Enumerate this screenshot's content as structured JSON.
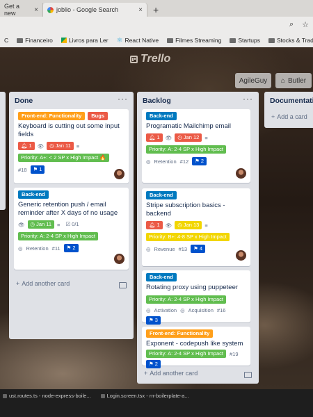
{
  "browser": {
    "tabs": [
      {
        "label": "Get a new"
      },
      {
        "label": "joblio - Google Search"
      }
    ],
    "new_tab": "+",
    "bookmarks": [
      "C",
      "Financeiro",
      "Livros para Ler",
      "React Native",
      "Filmes Streaming",
      "Startups",
      "Stocks & Trading..."
    ]
  },
  "board": {
    "logo": "Trello",
    "team_button": "AgileGuy",
    "butler_button": "Butler",
    "lists": {
      "done": {
        "title": "Done",
        "cards": [
          {
            "labels": [
              "Front-end: Functionality",
              "Bugs"
            ],
            "title": "Keyboard is cutting out some input fields",
            "votes": "1",
            "due": "Jan 11",
            "priority": "Priority: A+: < 2 SP x High Impact 🔥",
            "number": "#18",
            "tasks": "1"
          },
          {
            "labels": [
              "Back-end"
            ],
            "title": "Generic retention push / email reminder after X days of no usage",
            "due": "Jan 11",
            "checklist": "0/1",
            "priority": "Priority: A: 2-4 SP x High Impact",
            "category": "Retention",
            "number": "#11",
            "tasks": "2"
          }
        ],
        "add_card": "Add another card"
      },
      "backlog": {
        "title": "Backlog",
        "cards": [
          {
            "labels": [
              "Back-end"
            ],
            "title": "Programatic Mailchimp email",
            "votes": "1",
            "due": "Jan 12",
            "priority": "Priority: A: 2-4 SP x High Impact",
            "category": "Retention",
            "number": "#12",
            "tasks": "2"
          },
          {
            "labels": [
              "Back-end"
            ],
            "title": "Stripe subscription basics - backend",
            "votes": "1",
            "due": "Jan 13",
            "priority": "Priority: B+: 4-8 SP x High Impact",
            "category": "Revenue",
            "number": "#13",
            "tasks": "4"
          },
          {
            "labels": [
              "Back-end"
            ],
            "title": "Rotating proxy using puppeteer",
            "priority": "Priority: A: 2-4 SP x High Impact",
            "category": "Activation",
            "category2": "Acquisition",
            "number": "#16",
            "tasks": "3"
          },
          {
            "labels": [
              "Front-end: Functionality"
            ],
            "title": "Exponent - codepush like system",
            "priority": "Priority: A: 2-4 SP x High Impact",
            "number": "#19",
            "tasks": "2"
          }
        ],
        "add_card": "Add another card"
      },
      "documentation": {
        "title": "Documentation",
        "add_card": "Add a card"
      }
    }
  },
  "taskbar": {
    "items": [
      "ust.routes.ts - node-express-boile...",
      "Login.screen.tsx - rn-boilerplate-a..."
    ]
  },
  "colors": {
    "label_orange": "#ff9f1a",
    "label_red": "#eb5a46",
    "label_blue": "#0079bf",
    "due_green": "#61bd4f",
    "due_yellow": "#f2d600",
    "task_navy": "#0052cc"
  }
}
